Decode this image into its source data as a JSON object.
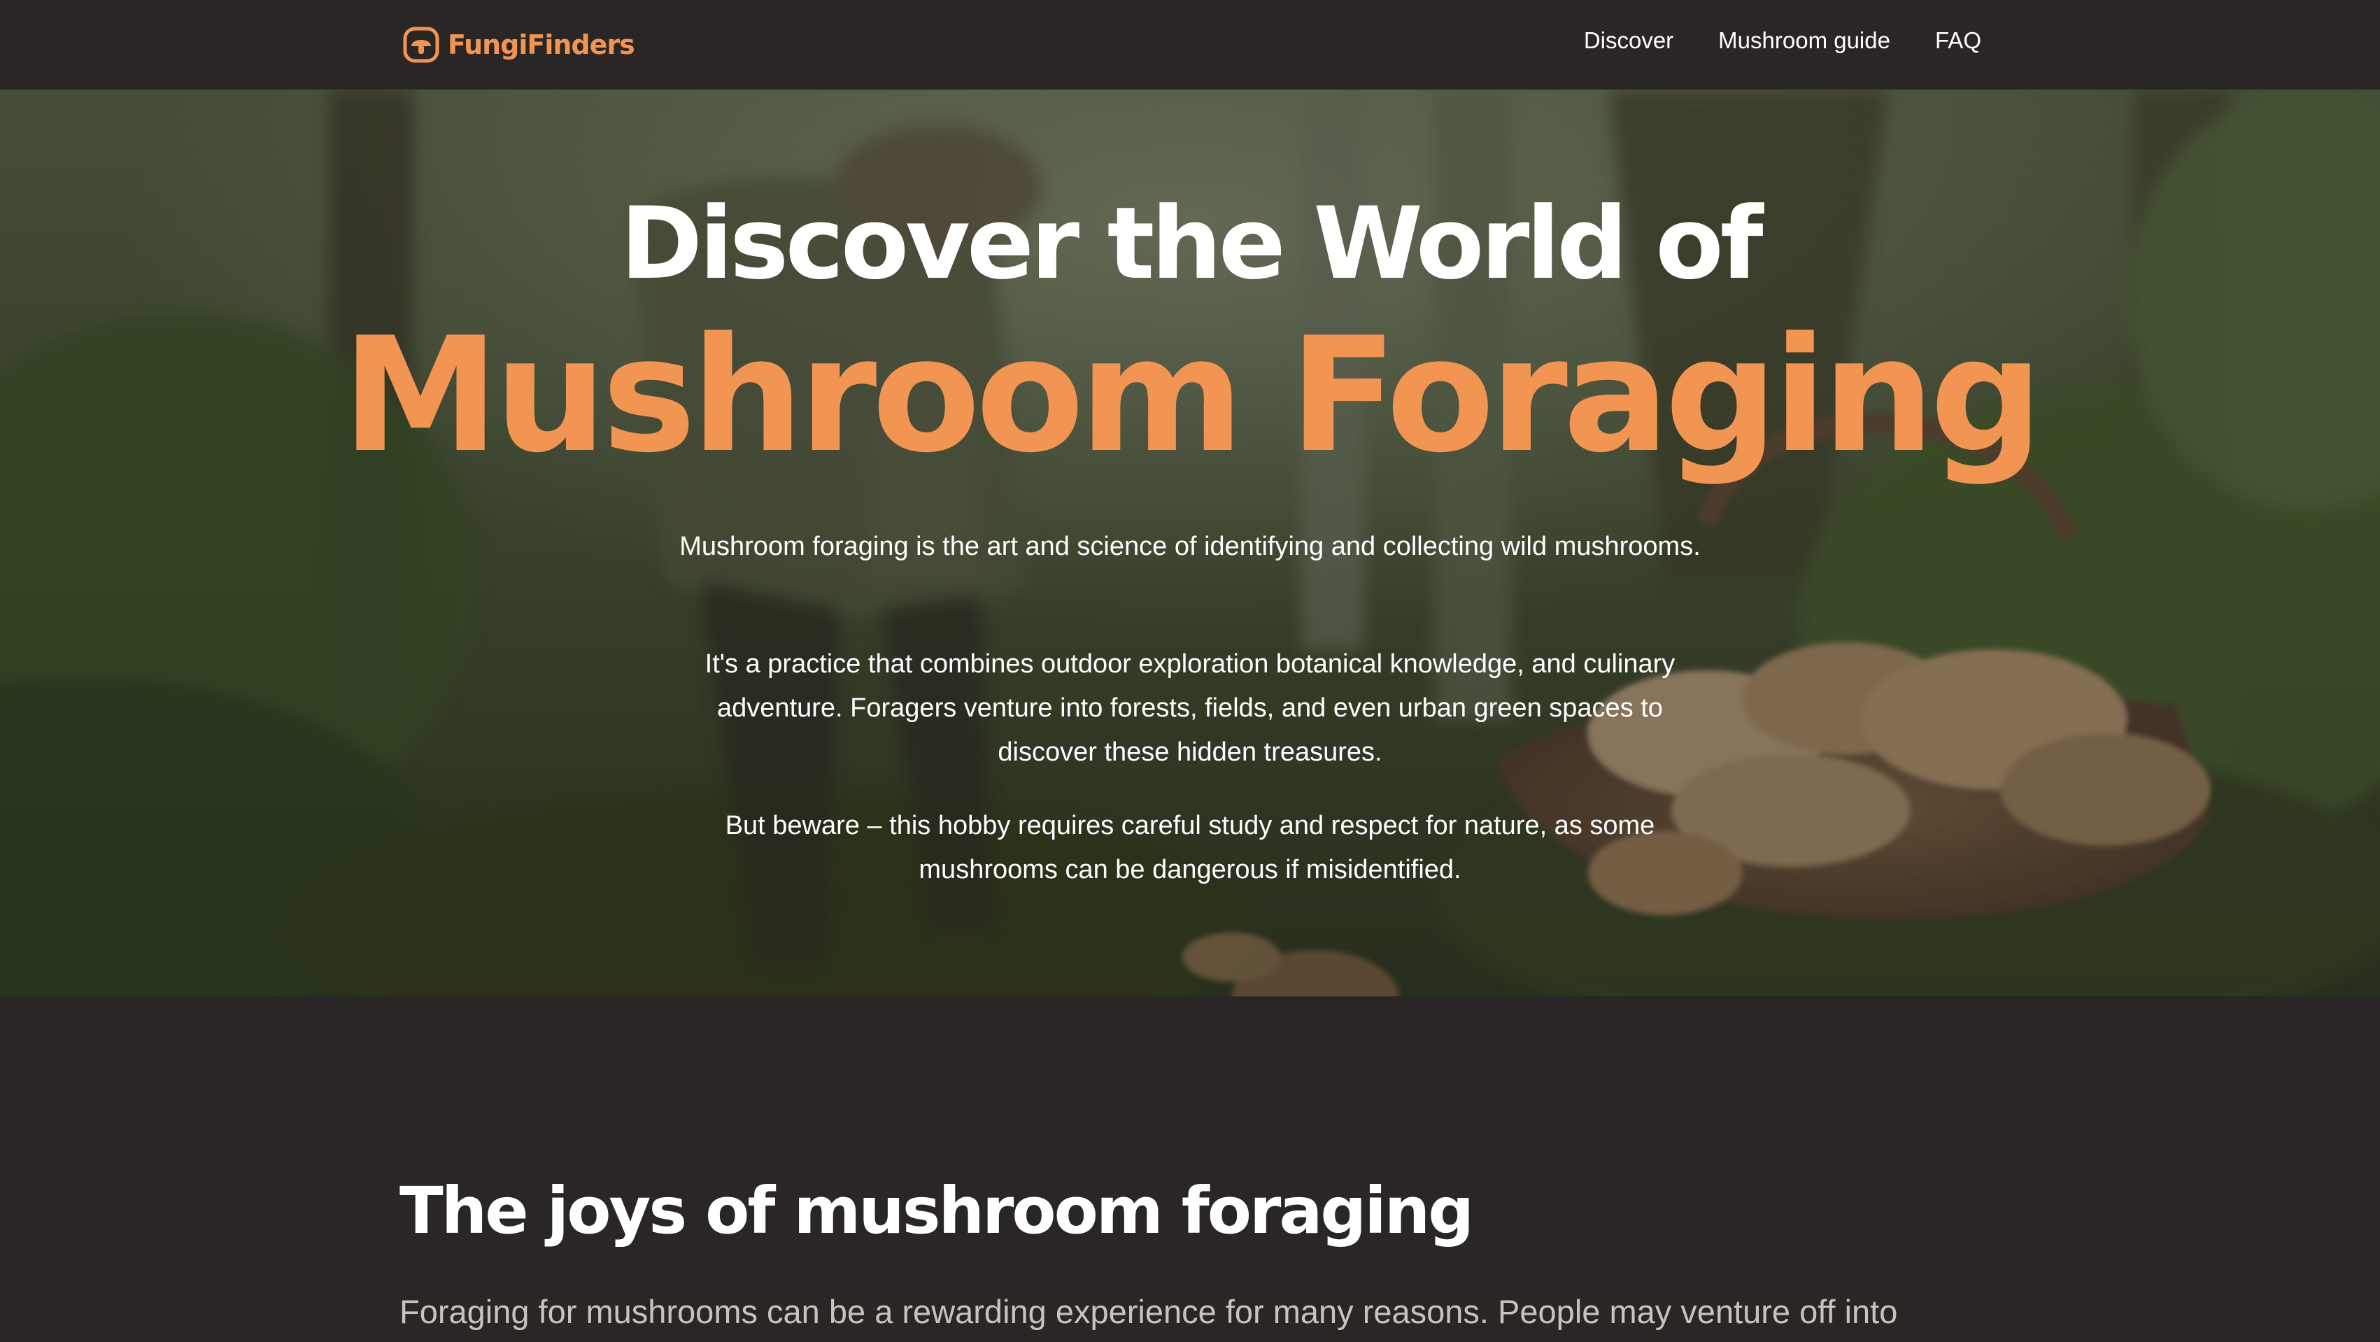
{
  "nav": {
    "brand_name": "FungiFinders",
    "brand_color": "#f29553",
    "links": [
      {
        "label": "Discover"
      },
      {
        "label": "Mushroom guide"
      },
      {
        "label": "FAQ"
      }
    ]
  },
  "hero": {
    "title_line1": "Discover the World of",
    "title_line2": "Mushroom Foraging",
    "paragraphs": [
      "Mushroom foraging is the art and science of identifying and collecting wild mushrooms.",
      "It's a practice that combines outdoor exploration botanical knowledge, and culinary adventure. Foragers venture into forests, fields, and even urban green spaces to discover these hidden treasures.",
      "But beware – this hobby requires careful study and respect for nature, as some mushrooms can be dangerous if misidentified."
    ],
    "background": "photo of a forager in a mossy forest with a wicker basket of mushrooms"
  },
  "joys": {
    "title": "The joys of mushroom foraging",
    "intro": "Foraging for mushrooms can be a rewarding experience for many reasons. People may venture off into"
  },
  "colors": {
    "page_background": "#2b2626",
    "accent": "#f29553",
    "text_primary": "#ffffff",
    "text_muted": "#c9c3bd"
  },
  "icons": {
    "brand": "mushroom-logo-icon"
  }
}
